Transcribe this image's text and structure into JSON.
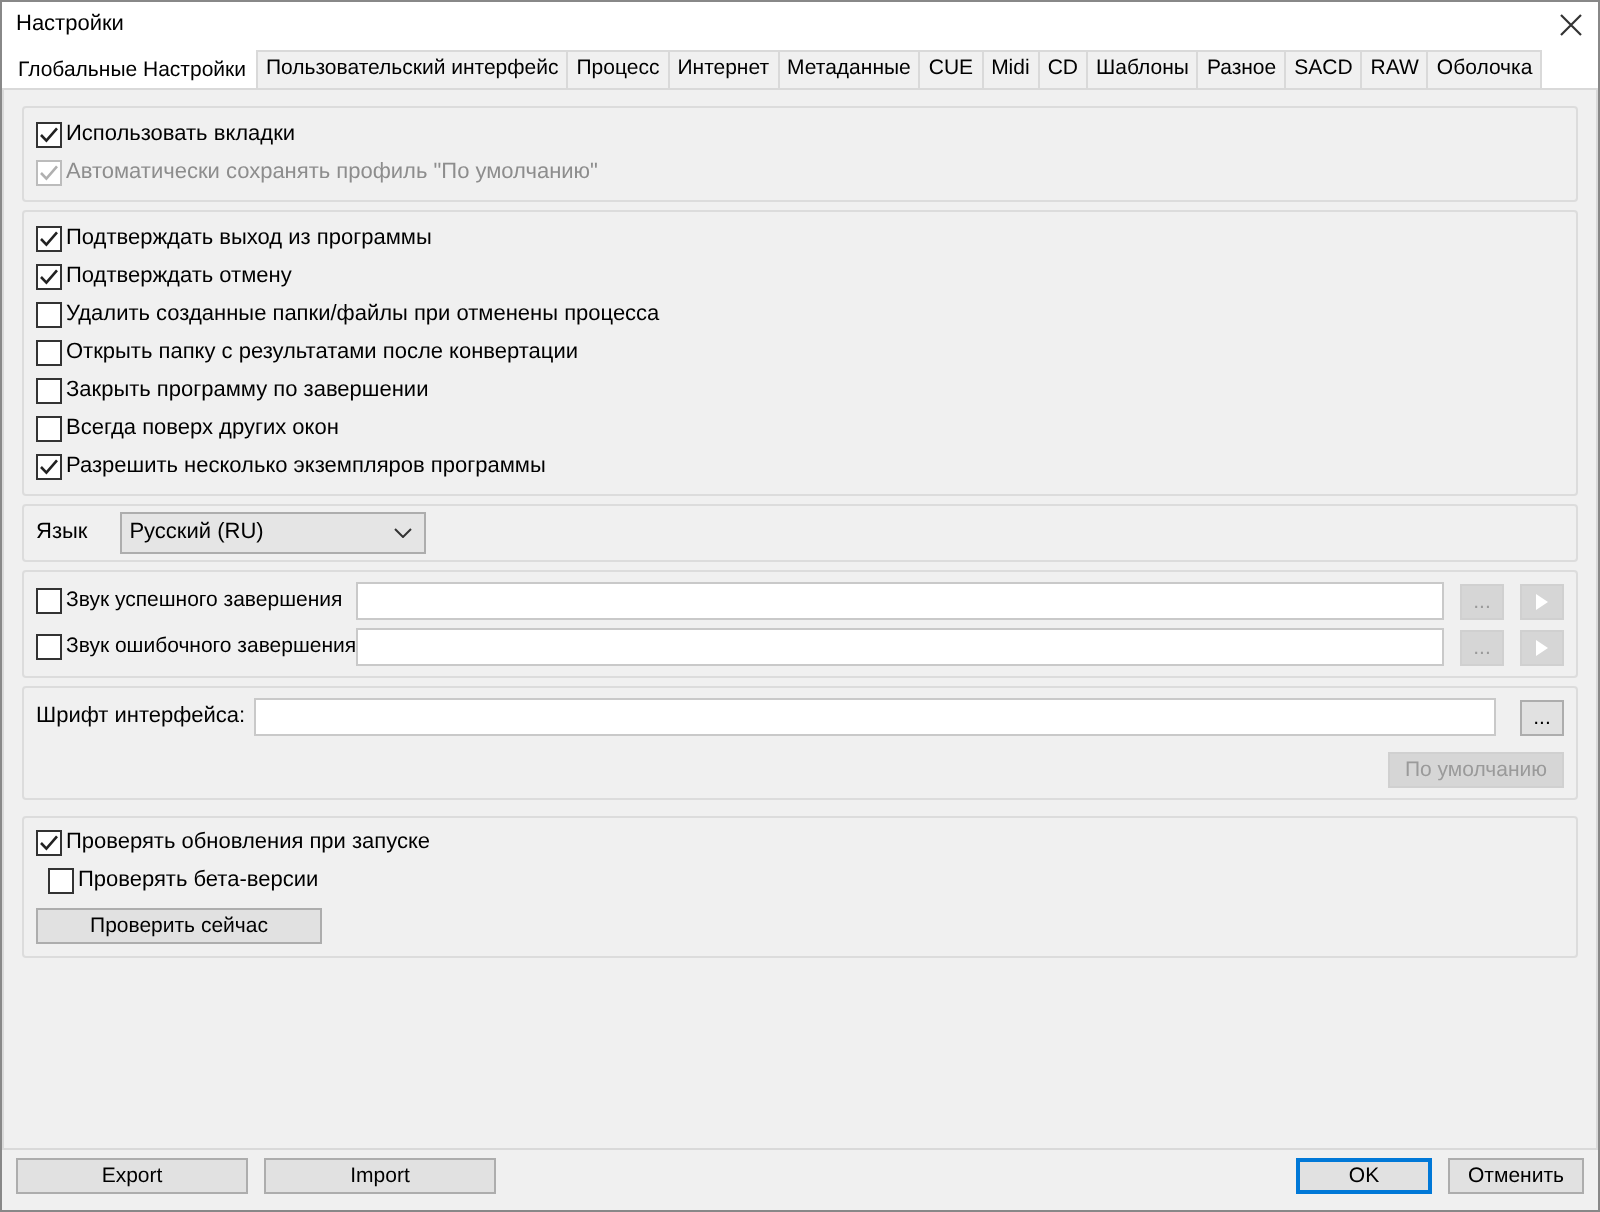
{
  "window": {
    "title": "Настройки"
  },
  "tabs": [
    {
      "label": "Глобальные Настройки",
      "selected": true
    },
    {
      "label": "Пользовательский интерфейс",
      "selected": false
    },
    {
      "label": "Процесс",
      "selected": false
    },
    {
      "label": "Интернет",
      "selected": false
    },
    {
      "label": "Метаданные",
      "selected": false
    },
    {
      "label": "CUE",
      "selected": false
    },
    {
      "label": "Midi",
      "selected": false
    },
    {
      "label": "CD",
      "selected": false
    },
    {
      "label": "Шаблоны",
      "selected": false
    },
    {
      "label": "Разное",
      "selected": false
    },
    {
      "label": "SACD",
      "selected": false
    },
    {
      "label": "RAW",
      "selected": false
    },
    {
      "label": "Оболочка",
      "selected": false
    }
  ],
  "tab_options": [
    {
      "label": "Использовать вкладки",
      "checked": true,
      "disabled": false
    },
    {
      "label": "Автоматически сохранять профиль \"По умолчанию\"",
      "checked": true,
      "disabled": true
    }
  ],
  "general_options": [
    {
      "label": "Подтверждать выход из программы",
      "checked": true,
      "disabled": false
    },
    {
      "label": "Подтверждать отмену",
      "checked": true,
      "disabled": false
    },
    {
      "label": "Удалить созданные папки/файлы при отменены процесса",
      "checked": false,
      "disabled": false
    },
    {
      "label": "Открыть папку с результатами после конвертации",
      "checked": false,
      "disabled": false
    },
    {
      "label": "Закрыть программу по завершении",
      "checked": false,
      "disabled": false
    },
    {
      "label": "Всегда поверх других окон",
      "checked": false,
      "disabled": false
    },
    {
      "label": "Разрешить несколько экземпляров программы",
      "checked": true,
      "disabled": false
    }
  ],
  "language": {
    "label": "Язык",
    "value": "Русский (RU)"
  },
  "sounds": [
    {
      "label": "Звук успешного завершения",
      "checked": false,
      "browse": "...",
      "buttons_disabled": true
    },
    {
      "label": "Звук ошибочного завершения",
      "checked": false,
      "browse": "...",
      "buttons_disabled": true
    }
  ],
  "font": {
    "label": "Шрифт интерфейса:",
    "browse": "...",
    "default_button": "По умолчанию",
    "default_disabled": true
  },
  "updates": {
    "options": [
      {
        "label": "Проверять обновления при запуске",
        "checked": true,
        "disabled": false,
        "indented": false
      },
      {
        "label": "Проверять бета-версии",
        "checked": false,
        "disabled": false,
        "indented": true
      }
    ],
    "button": "Проверить сейчас"
  },
  "footer": {
    "left_buttons": [
      "Export",
      "Import"
    ],
    "right_buttons": [
      {
        "label": "OK",
        "default": true
      },
      {
        "label": "Отменить",
        "default": false
      }
    ]
  }
}
